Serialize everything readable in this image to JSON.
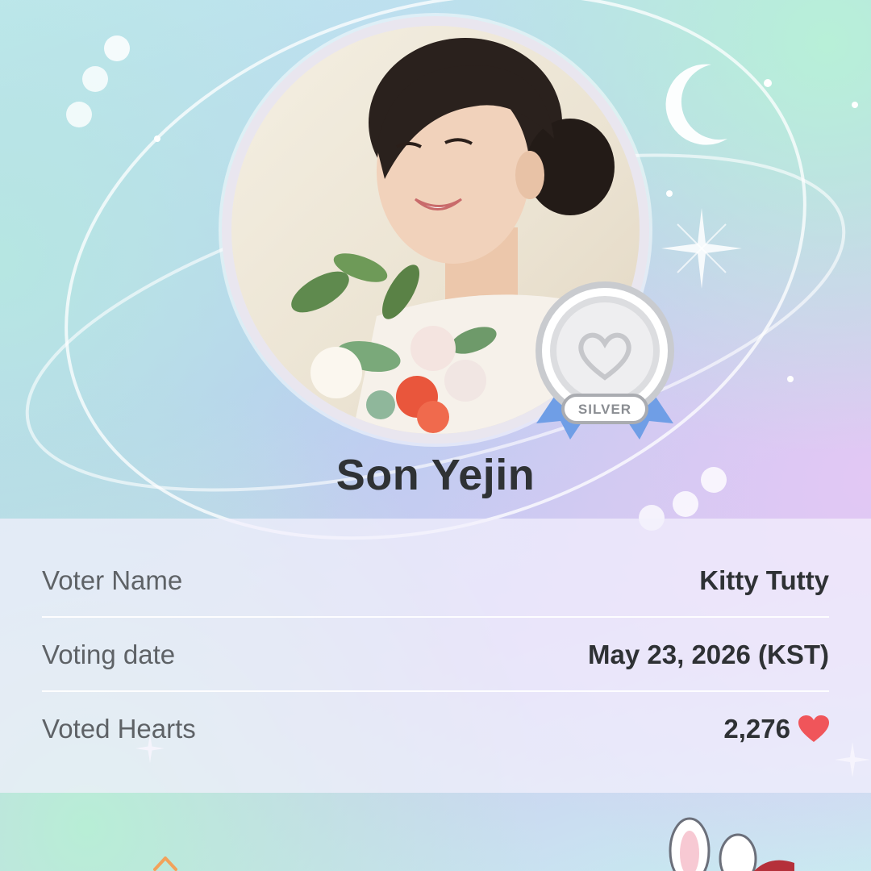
{
  "profile": {
    "name": "Son Yejin",
    "badge_label": "SILVER"
  },
  "details": {
    "rows": [
      {
        "label": "Voter Name",
        "value": "Kitty Tutty"
      },
      {
        "label": "Voting date",
        "value": "May 23, 2026 (KST)"
      },
      {
        "label": "Voted Hearts",
        "value": "2,276"
      }
    ]
  },
  "icons": {
    "moon": "crescent-moon-icon",
    "sparkle": "sparkle-icon",
    "heart": "heart-icon",
    "medal": "silver-medal-icon",
    "bunny": "bunny-icon"
  },
  "colors": {
    "heart": "#f0555a",
    "medal_ribbon": "#6f9ee6",
    "medal_silver": "#c9cbcf",
    "name_text": "#2f3235"
  }
}
